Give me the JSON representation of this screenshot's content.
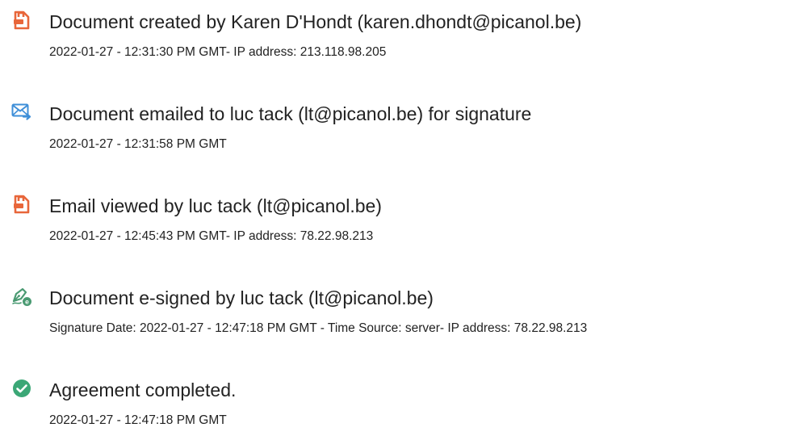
{
  "colors": {
    "doc_icon": "#E8663A",
    "email_icon": "#3F8FD8",
    "sign_icon": "#4A9A72",
    "check_icon": "#3BA776",
    "text": "#222222"
  },
  "events": [
    {
      "icon": "document-icon",
      "title": "Document created by Karen D'Hondt (karen.dhondt@picanol.be)",
      "detail": "2022-01-27 - 12:31:30 PM GMT- IP address: 213.118.98.205"
    },
    {
      "icon": "email-send-icon",
      "title": "Document emailed to luc tack (lt@picanol.be) for signature",
      "detail": "2022-01-27 - 12:31:58 PM GMT"
    },
    {
      "icon": "document-icon",
      "title": "Email viewed by luc tack (lt@picanol.be)",
      "detail": "2022-01-27 - 12:45:43 PM GMT- IP address: 78.22.98.213"
    },
    {
      "icon": "e-sign-pen-icon",
      "title": "Document e-signed by luc tack (lt@picanol.be)",
      "detail": "Signature Date: 2022-01-27 - 12:47:18 PM GMT - Time Source: server- IP address: 78.22.98.213"
    },
    {
      "icon": "check-circle-icon",
      "title": "Agreement completed.",
      "detail": "2022-01-27 - 12:47:18 PM GMT"
    }
  ]
}
